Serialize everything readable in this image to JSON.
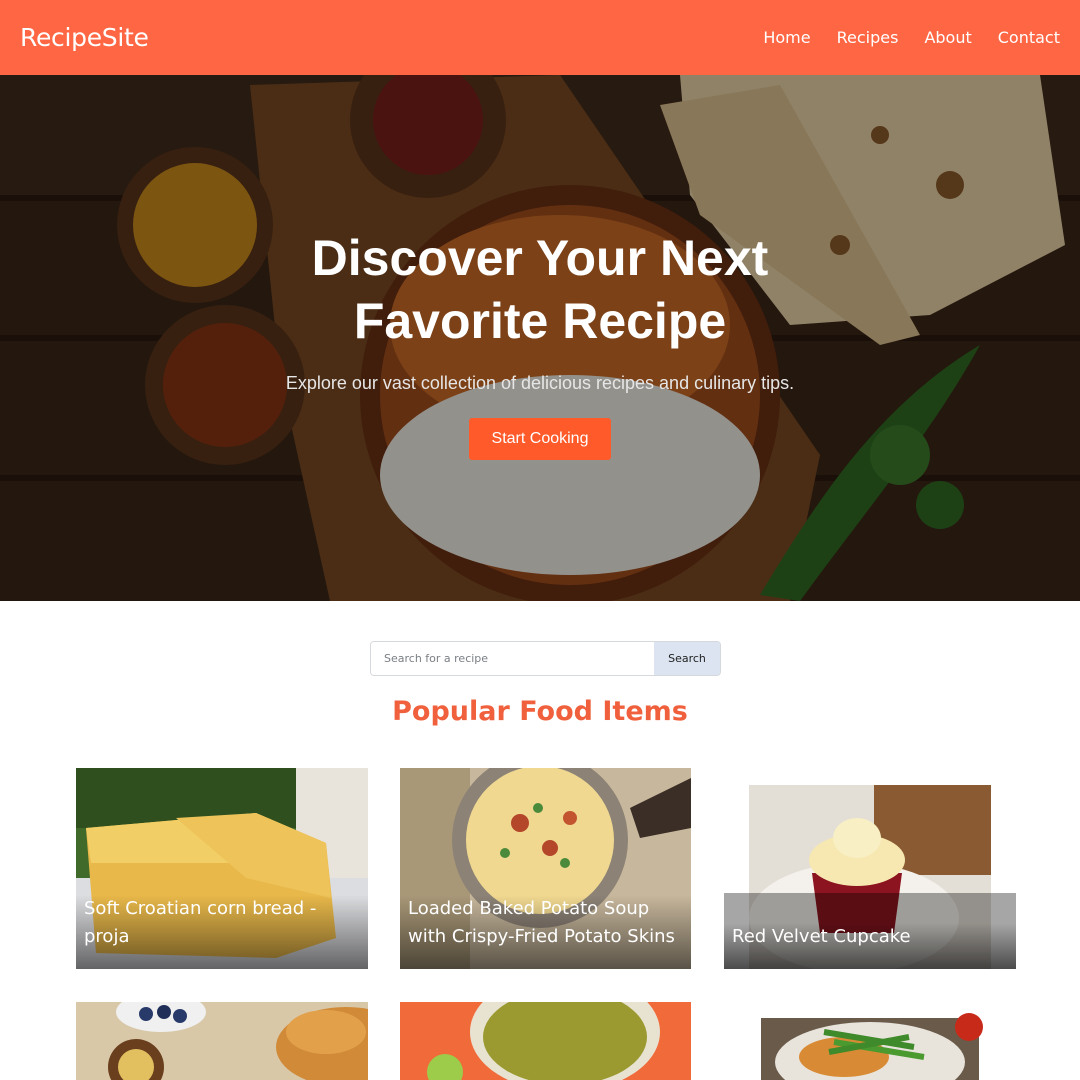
{
  "header": {
    "brand": "RecipeSite",
    "nav": [
      "Home",
      "Recipes",
      "About",
      "Contact"
    ]
  },
  "hero": {
    "title": "Discover Your Next Favorite Recipe",
    "subtitle": "Explore our vast collection of delicious recipes and culinary tips.",
    "cta_label": "Start Cooking"
  },
  "search": {
    "placeholder": "Search for a recipe",
    "button_label": "Search"
  },
  "popular": {
    "title": "Popular Food Items",
    "cards": [
      {
        "caption": "Soft Croatian corn bread - proja"
      },
      {
        "caption": "Loaded Baked Potato Soup with Crispy-Fried Potato Skins"
      },
      {
        "caption": "Red Velvet Cupcake"
      }
    ]
  },
  "colors": {
    "accent": "#ff6644",
    "cta": "#ff5a2a",
    "section_title": "#f0603c"
  }
}
